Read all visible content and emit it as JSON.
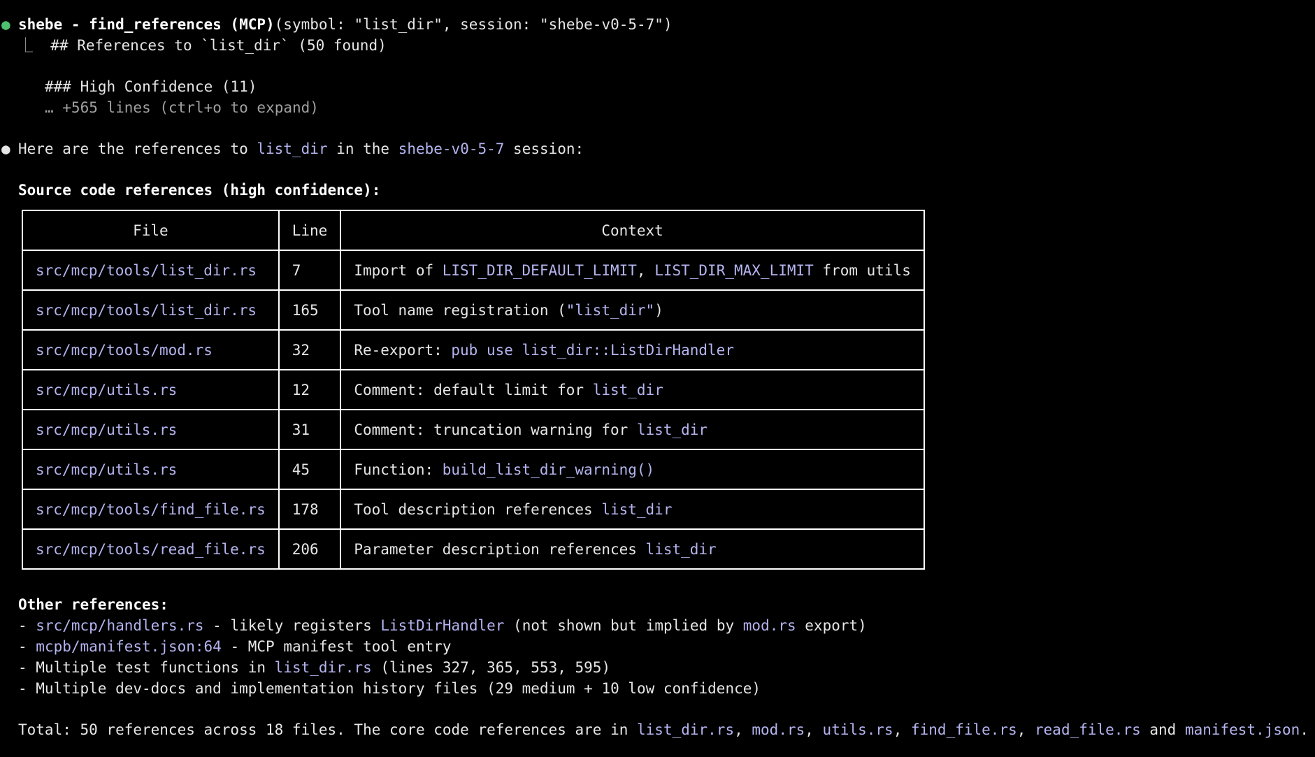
{
  "tool_call": {
    "bullet": "●",
    "name": "shebe - find_references (MCP)",
    "args": "(symbol: \"list_dir\", session: \"shebe-v0-5-7\")",
    "result_prefix": "⎿",
    "result_line1": "## References to `list_dir` (50 found)",
    "result_line2": "### High Confidence (11)",
    "result_line3": "… +565 lines (ctrl+o to expand)"
  },
  "answer": {
    "bullet": "●",
    "intro_a": "Here are the references to ",
    "intro_symbol": "list_dir",
    "intro_b": " in the ",
    "intro_session": "shebe-v0-5-7",
    "intro_c": " session:",
    "source_heading": "Source code references (high confidence):",
    "table": {
      "headers": [
        "File",
        "Line",
        "Context"
      ],
      "rows": [
        {
          "file": "src/mcp/tools/list_dir.rs",
          "line": "7",
          "ctx": [
            [
              "Import of ",
              false
            ],
            [
              "LIST_DIR_DEFAULT_LIMIT",
              true
            ],
            [
              ", ",
              false
            ],
            [
              "LIST_DIR_MAX_LIMIT",
              true
            ],
            [
              " from utils",
              false
            ]
          ]
        },
        {
          "file": "src/mcp/tools/list_dir.rs",
          "line": "165",
          "ctx": [
            [
              "Tool name registration (",
              false
            ],
            [
              "\"list_dir\"",
              true
            ],
            [
              ")",
              false
            ]
          ]
        },
        {
          "file": "src/mcp/tools/mod.rs",
          "line": "32",
          "ctx": [
            [
              "Re-export: ",
              false
            ],
            [
              "pub use list_dir::ListDirHandler",
              true
            ]
          ]
        },
        {
          "file": "src/mcp/utils.rs",
          "line": "12",
          "ctx": [
            [
              "Comment: default limit for ",
              false
            ],
            [
              "list_dir",
              true
            ]
          ]
        },
        {
          "file": "src/mcp/utils.rs",
          "line": "31",
          "ctx": [
            [
              "Comment: truncation warning for ",
              false
            ],
            [
              "list_dir",
              true
            ]
          ]
        },
        {
          "file": "src/mcp/utils.rs",
          "line": "45",
          "ctx": [
            [
              "Function: ",
              false
            ],
            [
              "build_list_dir_warning()",
              true
            ]
          ]
        },
        {
          "file": "src/mcp/tools/find_file.rs",
          "line": "178",
          "ctx": [
            [
              "Tool description references ",
              false
            ],
            [
              "list_dir",
              true
            ]
          ]
        },
        {
          "file": "src/mcp/tools/read_file.rs",
          "line": "206",
          "ctx": [
            [
              "Parameter description references ",
              false
            ],
            [
              "list_dir",
              true
            ]
          ]
        }
      ]
    },
    "other_heading": "Other references:",
    "other_items": [
      [
        [
          "- ",
          false
        ],
        [
          "src/mcp/handlers.rs",
          true
        ],
        [
          " - likely registers ",
          false
        ],
        [
          "ListDirHandler",
          true
        ],
        [
          " (not shown but implied by ",
          false
        ],
        [
          "mod.rs",
          true
        ],
        [
          " export)",
          false
        ]
      ],
      [
        [
          "- ",
          false
        ],
        [
          "mcpb/manifest.json:64",
          true
        ],
        [
          " - MCP manifest tool entry",
          false
        ]
      ],
      [
        [
          "- Multiple test functions in ",
          false
        ],
        [
          "list_dir.rs",
          true
        ],
        [
          " (lines 327, 365, 553, 595)",
          false
        ]
      ],
      [
        [
          "- Multiple dev-docs and implementation history files (29 medium + 10 low confidence)",
          false
        ]
      ]
    ],
    "total_line": [
      [
        "Total: 50 references across 18 files. The core code references are in ",
        false
      ],
      [
        "list_dir.rs",
        true
      ],
      [
        ", ",
        false
      ],
      [
        "mod.rs",
        true
      ],
      [
        ", ",
        false
      ],
      [
        "utils.rs",
        true
      ],
      [
        ", ",
        false
      ],
      [
        "find_file.rs",
        true
      ],
      [
        ", ",
        false
      ],
      [
        "read_file.rs",
        true
      ],
      [
        " and ",
        false
      ],
      [
        "manifest.json",
        true
      ],
      [
        ".",
        false
      ]
    ]
  },
  "colors": {
    "background": "#000000",
    "text": "#e6e6e6",
    "highlight": "#b4b4f0",
    "success_dot": "#4ec06e",
    "dim": "#a0a0a0"
  }
}
